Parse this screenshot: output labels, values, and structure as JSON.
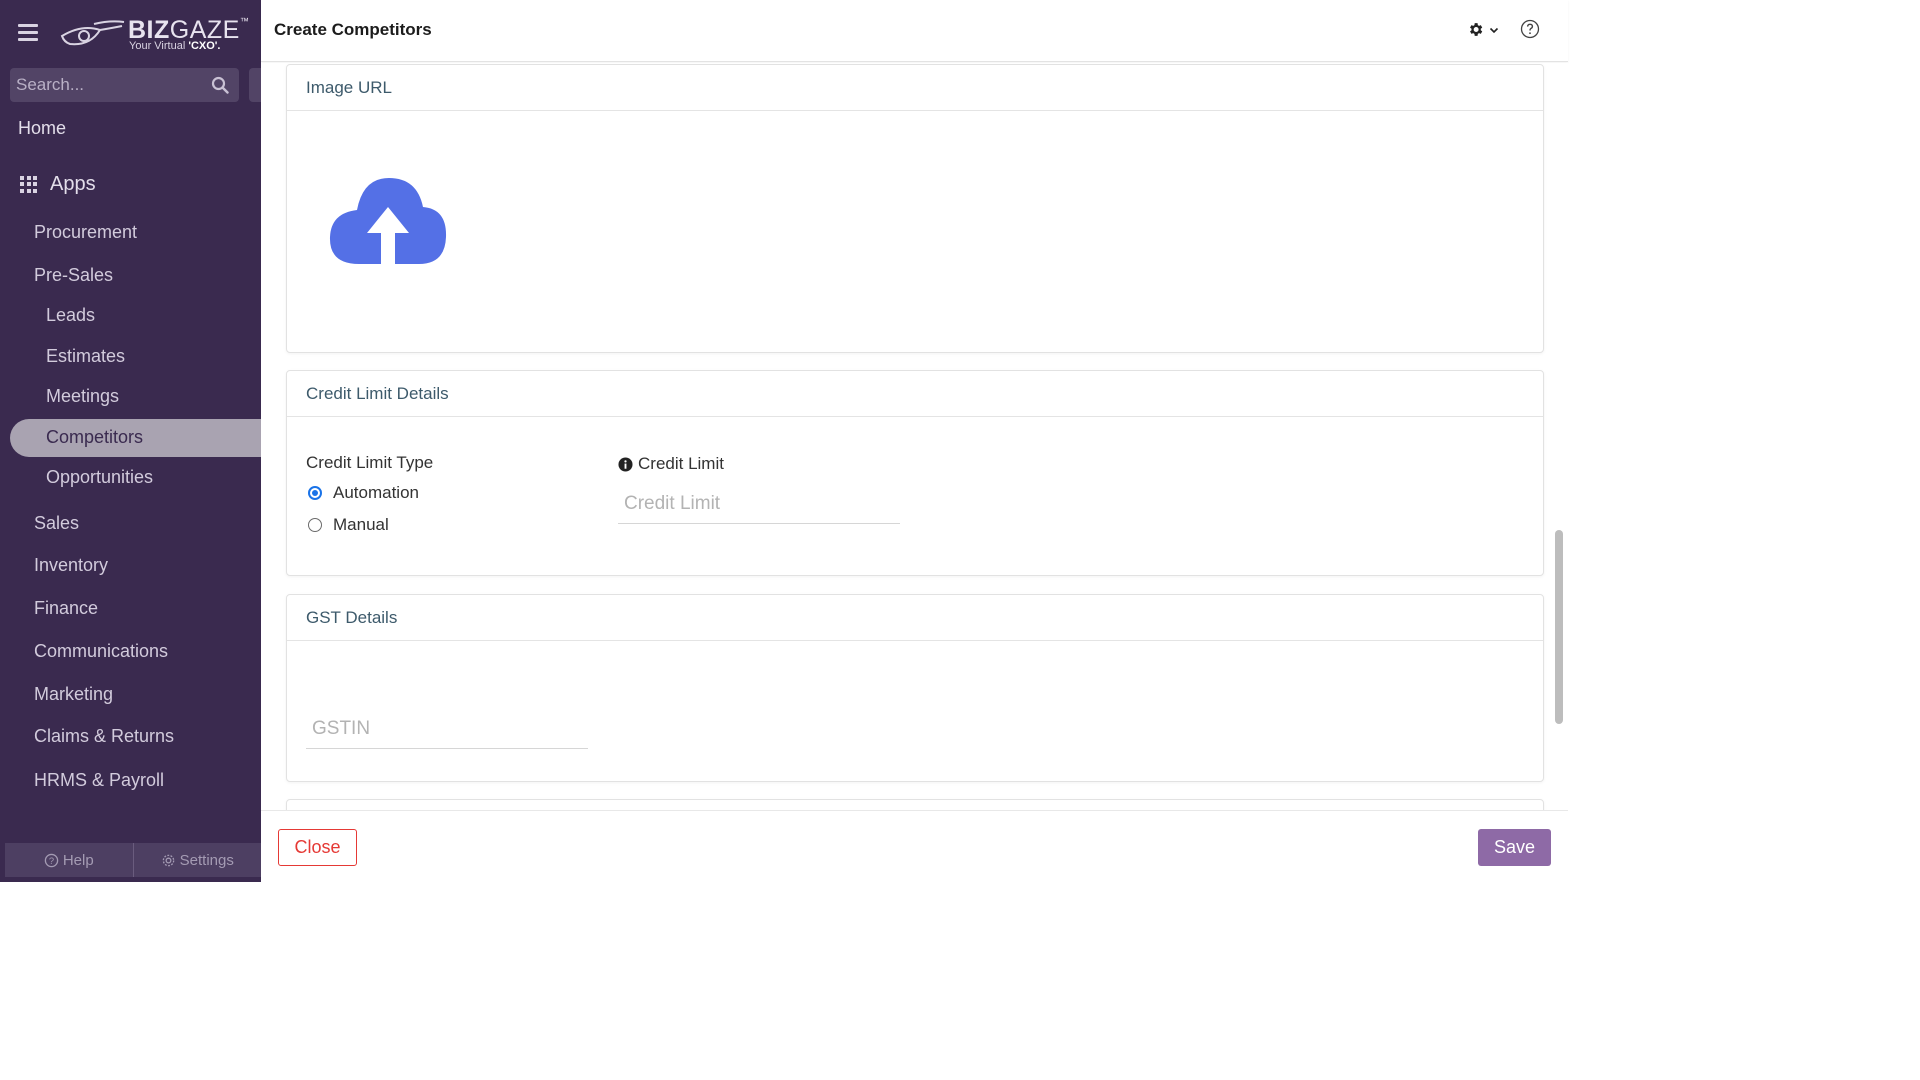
{
  "brand": {
    "name_bold": "BIZ",
    "name_light": "GAZE",
    "trademark": "™",
    "tagline_prefix": "Your Virtual ",
    "tagline_bold": "'CXO'."
  },
  "search": {
    "placeholder": "Search..."
  },
  "sidebar": {
    "home": "Home",
    "apps": "Apps",
    "items": [
      {
        "label": "Procurement",
        "level": "top"
      },
      {
        "label": "Pre-Sales",
        "level": "top"
      },
      {
        "label": "Leads",
        "level": "sub"
      },
      {
        "label": "Estimates",
        "level": "sub"
      },
      {
        "label": "Meetings",
        "level": "sub"
      },
      {
        "label": "Competitors",
        "level": "sub",
        "active": true
      },
      {
        "label": "Opportunities",
        "level": "sub"
      },
      {
        "label": "Sales",
        "level": "top"
      },
      {
        "label": "Inventory",
        "level": "top"
      },
      {
        "label": "Finance",
        "level": "top"
      },
      {
        "label": "Communications",
        "level": "top"
      },
      {
        "label": "Marketing",
        "level": "top"
      },
      {
        "label": "Claims & Returns",
        "level": "top"
      },
      {
        "label": "HRMS & Payroll",
        "level": "top"
      }
    ],
    "bottom": {
      "help": "Help",
      "settings": "Settings"
    }
  },
  "header": {
    "title": "Create Competitors"
  },
  "sections": {
    "image": {
      "title": "Image URL"
    },
    "credit": {
      "title": "Credit Limit Details",
      "type_label": "Credit Limit Type",
      "options": [
        {
          "label": "Automation",
          "checked": true
        },
        {
          "label": "Manual",
          "checked": false
        }
      ],
      "limit_label": "Credit Limit",
      "limit_placeholder": "Credit Limit",
      "limit_value": ""
    },
    "gst": {
      "title": "GST Details",
      "gstin_placeholder": "GSTIN",
      "gstin_value": ""
    }
  },
  "footer": {
    "close": "Close",
    "save": "Save"
  },
  "colors": {
    "sidebar_bg": "#3a2a4f",
    "accent": "#8e6aa6",
    "upload_icon": "#5470e6",
    "close": "#e53935",
    "radio": "#1a73e8"
  }
}
